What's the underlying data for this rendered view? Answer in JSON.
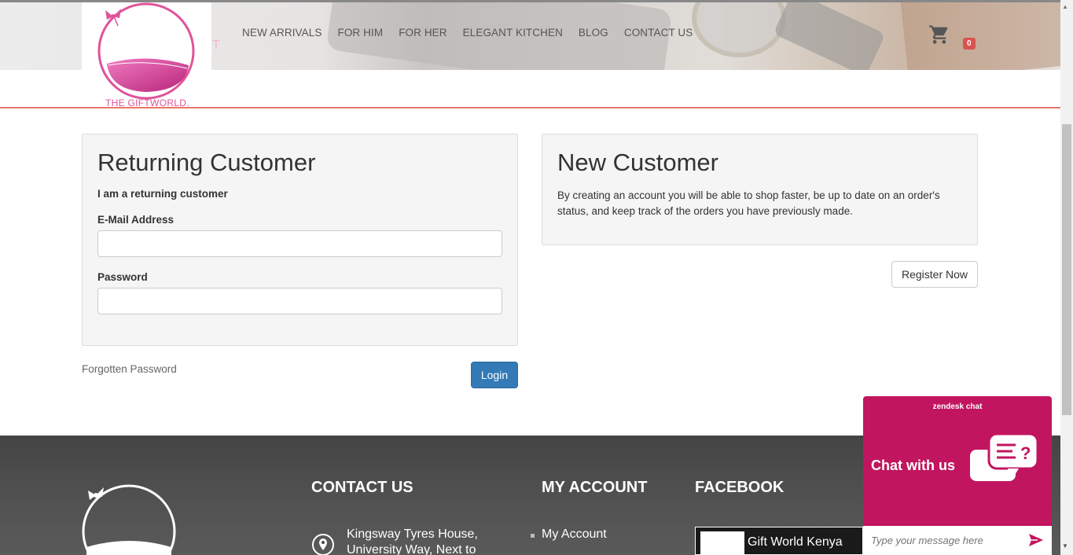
{
  "header": {
    "logo_text": "THE GIFTWORLD.",
    "nav": [
      "NEW ARRIVALS",
      "FOR HIM",
      "FOR HER",
      "ELEGANT KITCHEN",
      "BLOG",
      "CONTACT US"
    ],
    "cart_count": "0"
  },
  "returning": {
    "title": "Returning Customer",
    "subtitle": "I am a returning customer",
    "email_label": "E-Mail Address",
    "email_value": "",
    "password_label": "Password",
    "password_value": "",
    "forgot_label": "Forgotten Password",
    "login_label": "Login"
  },
  "new_customer": {
    "title": "New Customer",
    "text": "By creating an account you will be able to shop faster, be up to date on an order's status, and keep track of the orders you have previously made.",
    "register_label": "Register Now"
  },
  "footer": {
    "contact_title": "CONTACT US",
    "address": "Kingsway Tyres House, University Way, Next to",
    "account_title": "MY ACCOUNT",
    "my_account_link": "My Account",
    "facebook_title": "FACEBOOK",
    "facebook_page": "Gift World Kenya"
  },
  "chat": {
    "brand": "zendesk chat",
    "title": "Chat with us",
    "placeholder": "Type your message here"
  },
  "colors": {
    "accent": "#337ab7",
    "brand_pink": "#c2155f",
    "divider": "#e8776a",
    "badge": "#d9534f"
  }
}
